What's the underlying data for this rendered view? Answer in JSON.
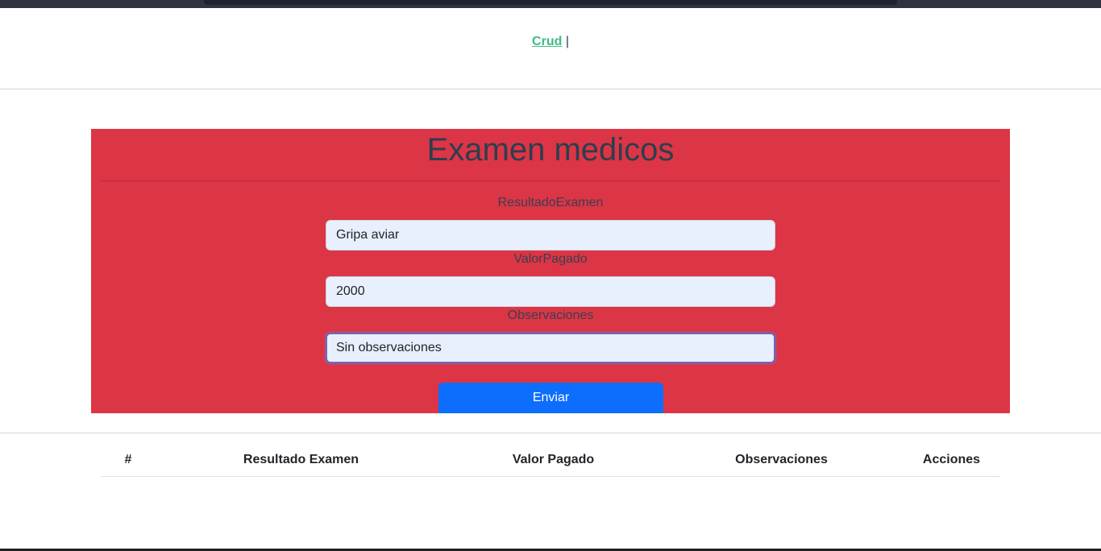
{
  "nav": {
    "link_label": "Crud",
    "separator": "|"
  },
  "card": {
    "title": "Examen medicos",
    "background_color": "#dc3545"
  },
  "form": {
    "fields": [
      {
        "label": "ResultadoExamen",
        "value": "Gripa aviar"
      },
      {
        "label": "ValorPagado",
        "value": "2000"
      },
      {
        "label": "Observaciones",
        "value": "Sin observaciones"
      }
    ],
    "submit_label": "Enviar"
  },
  "table": {
    "headers": [
      "#",
      "Resultado Examen",
      "Valor Pagado",
      "Observaciones",
      "Acciones"
    ],
    "rows": []
  }
}
